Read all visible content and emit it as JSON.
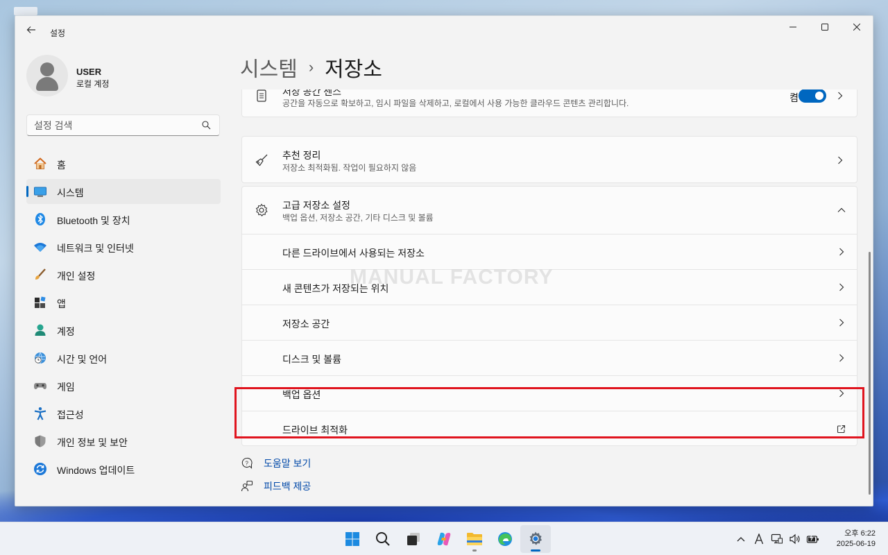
{
  "window": {
    "app_title": "설정",
    "minimize": "minimize",
    "maximize": "maximize",
    "close": "close"
  },
  "user": {
    "name": "USER",
    "account_type": "로컬 계정"
  },
  "search": {
    "placeholder": "설정 검색"
  },
  "sidebar": {
    "items": [
      {
        "label": "홈",
        "icon": "home-icon"
      },
      {
        "label": "시스템",
        "icon": "system-icon"
      },
      {
        "label": "Bluetooth 및 장치",
        "icon": "bluetooth-icon"
      },
      {
        "label": "네트워크 및 인터넷",
        "icon": "wifi-icon"
      },
      {
        "label": "개인 설정",
        "icon": "brush-icon"
      },
      {
        "label": "앱",
        "icon": "apps-icon"
      },
      {
        "label": "계정",
        "icon": "account-icon"
      },
      {
        "label": "시간 및 언어",
        "icon": "globe-clock-icon"
      },
      {
        "label": "게임",
        "icon": "gamepad-icon"
      },
      {
        "label": "접근성",
        "icon": "accessibility-icon"
      },
      {
        "label": "개인 정보 및 보안",
        "icon": "shield-icon"
      },
      {
        "label": "Windows 업데이트",
        "icon": "update-icon"
      }
    ],
    "active_index": 1
  },
  "breadcrumb": {
    "parent": "시스템",
    "separator": "›",
    "current": "저장소"
  },
  "cards": {
    "storage_sense": {
      "title": "저장 공간 센스",
      "desc": "공간을 자동으로 확보하고, 임시 파일을 삭제하고, 로컬에서 사용 가능한 클라우드 콘텐츠 관리합니다.",
      "toggle_label": "켬",
      "toggle_on": true
    },
    "cleanup": {
      "title": "추천 정리",
      "desc": "저장소 최적화됨. 작업이 필요하지 않음"
    },
    "advanced": {
      "title": "고급 저장소 설정",
      "desc": "백업 옵션, 저장소 공간, 기타 디스크 및 볼륨",
      "rows": [
        "다른 드라이브에서 사용되는 저장소",
        "새 콘텐츠가 저장되는 위치",
        "저장소 공간",
        "디스크 및 볼륨",
        "백업 옵션",
        "드라이브 최적화"
      ]
    }
  },
  "watermark": "MANUAL FACTORY",
  "help": {
    "get_help": "도움말 보기",
    "feedback": "피드백 제공"
  },
  "taskbar": {
    "apps": [
      "start-icon",
      "search-icon",
      "task-view-icon",
      "copilot-icon",
      "file-explorer-icon",
      "edge-icon",
      "settings-icon"
    ],
    "active_app": "settings-icon",
    "clock_time": "오후 6:22",
    "clock_date": "2025-06-19"
  },
  "colors": {
    "accent": "#0067c0",
    "highlight_box": "#e0141e",
    "link": "#0048a8"
  }
}
